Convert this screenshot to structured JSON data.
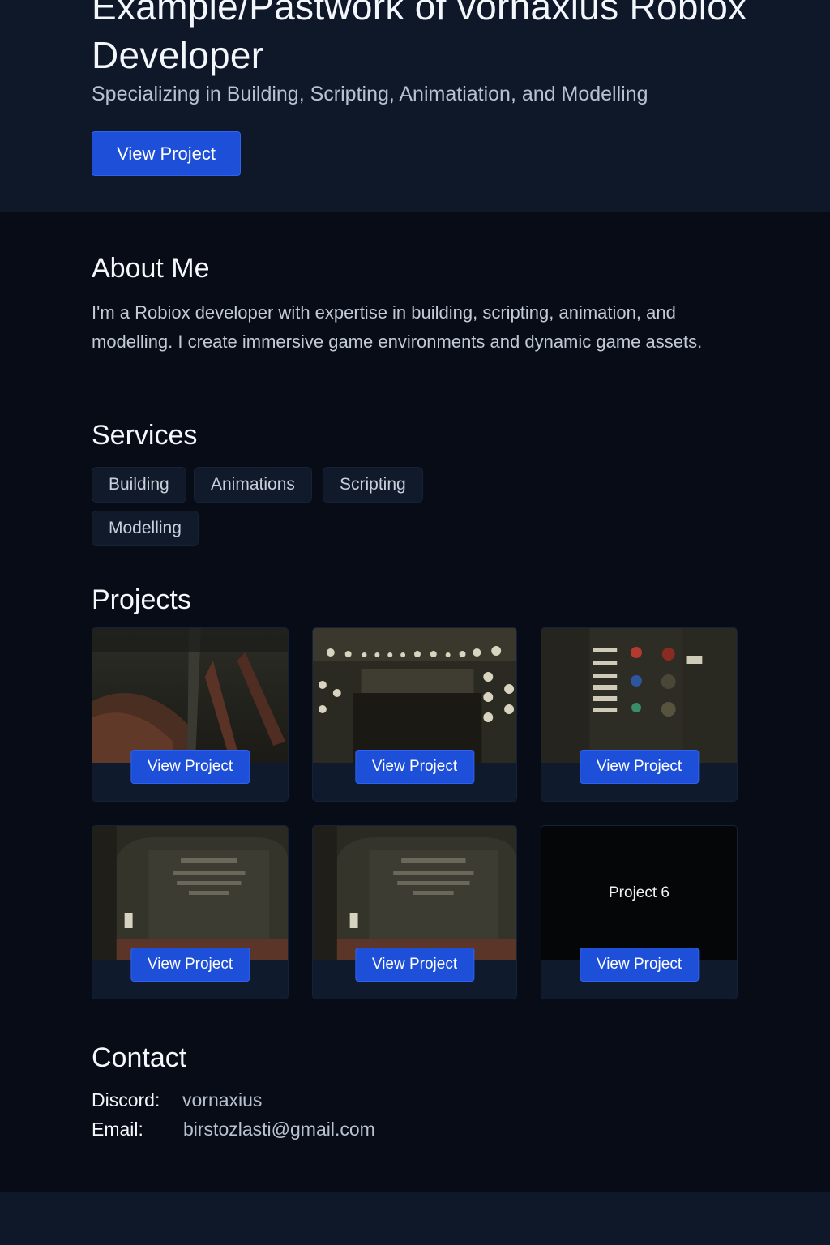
{
  "hero": {
    "title": "Example/Pastwork of vornaxius Roblox Developer",
    "subtitle": "Specializing in Building, Scripting, Animatiation, and Modelling",
    "button_label": "View Project"
  },
  "about": {
    "heading": "About Me",
    "text": "I'm a Robiox developer with expertise in building, scripting, animation, and modelling. I create immersive game environments and dynamic game assets."
  },
  "services": {
    "heading": "Services",
    "items": [
      "Building",
      "Animations",
      "Scripting",
      "Modelling"
    ]
  },
  "projects": {
    "heading": "Projects",
    "items": [
      {
        "button_label": "View Project",
        "image": "tunnel-interior"
      },
      {
        "button_label": "View Project",
        "image": "control-panel-lights"
      },
      {
        "button_label": "View Project",
        "image": "switch-panel"
      },
      {
        "button_label": "View Project",
        "image": "wall-sign-room"
      },
      {
        "button_label": "View Project",
        "image": "wall-sign-room"
      },
      {
        "button_label": "View Project",
        "placeholder": "Project 6"
      }
    ]
  },
  "contact": {
    "heading": "Contact",
    "discord_label": "Discord:",
    "discord_value": "vornaxius",
    "email_label": "Email:",
    "email_value": "birstozlasti@gmail.com"
  },
  "colors": {
    "accent": "#1d4fd8",
    "background": "#070c17",
    "hero_background": "#0e1829"
  }
}
